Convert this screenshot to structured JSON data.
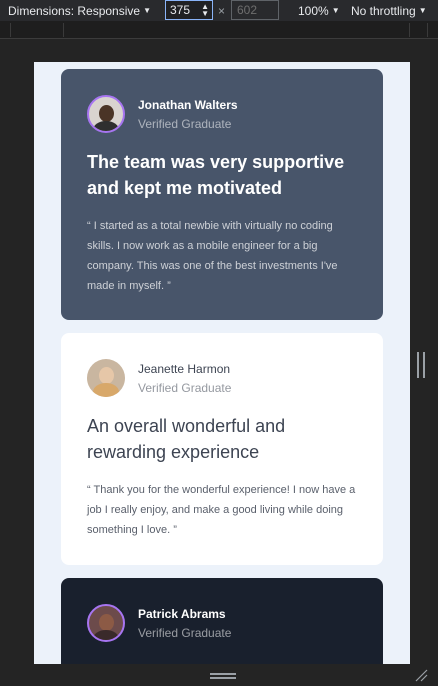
{
  "toolbar": {
    "dimensions_label": "Dimensions: Responsive",
    "width_value": "375",
    "times": "×",
    "height_placeholder": "602",
    "zoom": "100%",
    "throttling": "No throttling"
  },
  "testimonials": [
    {
      "name": "Jonathan Walters",
      "role": "Verified Graduate",
      "headline": "The team was very supportive and kept me motivated",
      "quote": "“ I started as a total newbie with virtually no coding skills. I now work as a mobile engineer for a big company. This was one of the best investments I've made in myself. ”"
    },
    {
      "name": "Jeanette Harmon",
      "role": "Verified Graduate",
      "headline": "An overall wonderful and rewarding experience",
      "quote": "“ Thank you for the wonderful experience! I now have a job I really enjoy, and make a good living while doing something I love. ”"
    },
    {
      "name": "Patrick Abrams",
      "role": "Verified Graduate"
    }
  ],
  "colors": {
    "card_1": "#48556a",
    "card_2": "#ffffff",
    "card_3": "#19202d",
    "avatar_border": "#a775f1",
    "page_background": "#ecf2fa"
  }
}
